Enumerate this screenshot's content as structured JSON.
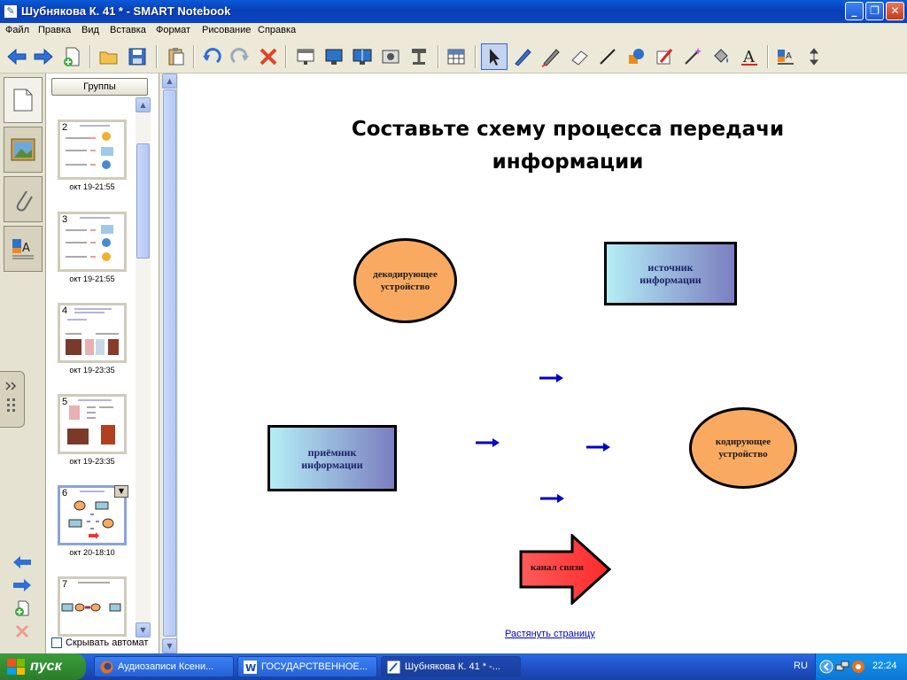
{
  "window": {
    "title": "Шубнякова К. 41 * - SMART Notebook",
    "app_icon": "smart-notebook-icon",
    "buttons": {
      "minimize": "_",
      "restore": "❐",
      "close": "✕"
    }
  },
  "menu": [
    "Файл",
    "Правка",
    "Вид",
    "Вставка",
    "Формат",
    "Рисование",
    "Справка"
  ],
  "toolbar": {
    "icons": [
      "back-arrow-icon",
      "forward-arrow-icon",
      "add-page-icon",
      "open-folder-icon",
      "save-icon",
      "paste-icon",
      "undo-icon",
      "redo-icon",
      "delete-icon",
      "screen-shade-icon",
      "full-screen-icon",
      "dual-page-icon",
      "screen-capture-icon",
      "document-camera-icon",
      "table-icon",
      "select-arrow-icon",
      "pen-icon",
      "creative-pen-icon",
      "eraser-icon",
      "line-icon",
      "shapes-icon",
      "magic-pen-icon",
      "magic-wand-icon",
      "fill-icon",
      "text-icon",
      "properties-icon",
      "move-toolbar-icon"
    ]
  },
  "sorter": {
    "groups_label": "Группы",
    "autohide_label": "Скрывать автомат",
    "pages": [
      {
        "num": "2",
        "date": "окт 19-21:55"
      },
      {
        "num": "3",
        "date": "окт 19-21:55"
      },
      {
        "num": "4",
        "date": "окт 19-23:35"
      },
      {
        "num": "5",
        "date": "окт 19-23:35"
      },
      {
        "num": "6",
        "date": "окт 20-18:10"
      },
      {
        "num": "7",
        "date": ""
      }
    ]
  },
  "slide": {
    "title": "Составьте схему процесса передачи информации",
    "decoder": "декодирующее устройство",
    "source": "источник информации",
    "receiver": "приёмник информации",
    "encoder": "кодирующее устройство",
    "channel": "канал связи",
    "stretch_link": "Растянуть страницу",
    "colors": {
      "ellipse": "#f9aa60",
      "rect_start": "#b4eef6",
      "rect_end": "#7b7ec0",
      "arrow_blue": "#0000cc",
      "channel_red": "#ff4040"
    }
  },
  "taskbar": {
    "start_label": "пуск",
    "tasks": [
      "Аудиозаписи Ксени...",
      "ГОСУДАРСТВЕННОЕ...",
      "Шубнякова К. 41 * -..."
    ],
    "lang": "RU",
    "clock": "22:24"
  }
}
